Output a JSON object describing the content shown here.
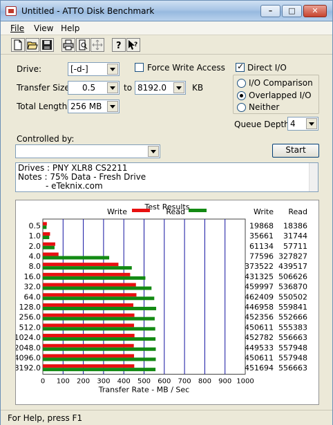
{
  "window": {
    "title": "Untitled - ATTO Disk Benchmark"
  },
  "titlebar": {
    "minimize_glyph": "–",
    "maximize_glyph": "□",
    "close_glyph": "✕"
  },
  "menu": {
    "items": [
      "File",
      "View",
      "Help"
    ]
  },
  "toolbar": {
    "icons": [
      "new-icon",
      "open-icon",
      "save-icon",
      "print-icon",
      "print-preview-icon",
      "move-icon",
      "help-icon",
      "context-help-icon"
    ]
  },
  "drive": {
    "label": "Drive:",
    "value": "[-d-]"
  },
  "transfer": {
    "label": "Transfer Size:",
    "from": "0.5",
    "to_label": "to",
    "to": "8192.0",
    "unit": "KB"
  },
  "length": {
    "label": "Total Length:",
    "value": "256 MB"
  },
  "force_write": {
    "label": "Force Write Access",
    "checked": false
  },
  "direct_io": {
    "label": "Direct I/O",
    "checked": true
  },
  "io_mode": {
    "options": [
      "I/O Comparison",
      "Overlapped I/O",
      "Neither"
    ],
    "selected": "Overlapped I/O"
  },
  "queue": {
    "label": "Queue Depth:",
    "value": "4"
  },
  "controlled_by": {
    "label": "Controlled by:",
    "value": ""
  },
  "start_button": "Start",
  "notes": {
    "line1": "Drives : PNY XLR8 CS2211",
    "line2": "Notes : 75% Data - Fresh Drive",
    "line3": "- eTeknix.com"
  },
  "status_text": "For Help, press F1",
  "colors": {
    "write": "#e81010",
    "read": "#138a13",
    "grid": "#1010a0"
  },
  "chart_data": {
    "type": "bar",
    "title": "Test Results",
    "xlabel": "Transfer Rate - MB / Sec",
    "xlim": [
      0,
      1000
    ],
    "xticks": [
      0,
      100,
      200,
      300,
      400,
      500,
      600,
      700,
      800,
      900,
      1000
    ],
    "orientation": "horizontal",
    "legend": [
      "Write",
      "Read"
    ],
    "column_headers": [
      "Write",
      "Read"
    ],
    "categories": [
      "0.5",
      "1.0",
      "2.0",
      "4.0",
      "8.0",
      "16.0",
      "32.0",
      "64.0",
      "128.0",
      "256.0",
      "512.0",
      "1024.0",
      "2048.0",
      "4096.0",
      "8192.0"
    ],
    "series": [
      {
        "name": "Write",
        "values": [
          19868,
          35661,
          61134,
          77596,
          373522,
          431325,
          459997,
          462409,
          446958,
          452356,
          450611,
          452782,
          449533,
          450611,
          451694
        ]
      },
      {
        "name": "Read",
        "values": [
          18386,
          31744,
          57711,
          327827,
          439517,
          506626,
          536870,
          550502,
          559841,
          552666,
          555383,
          556663,
          557948,
          557948,
          556663
        ]
      }
    ]
  }
}
